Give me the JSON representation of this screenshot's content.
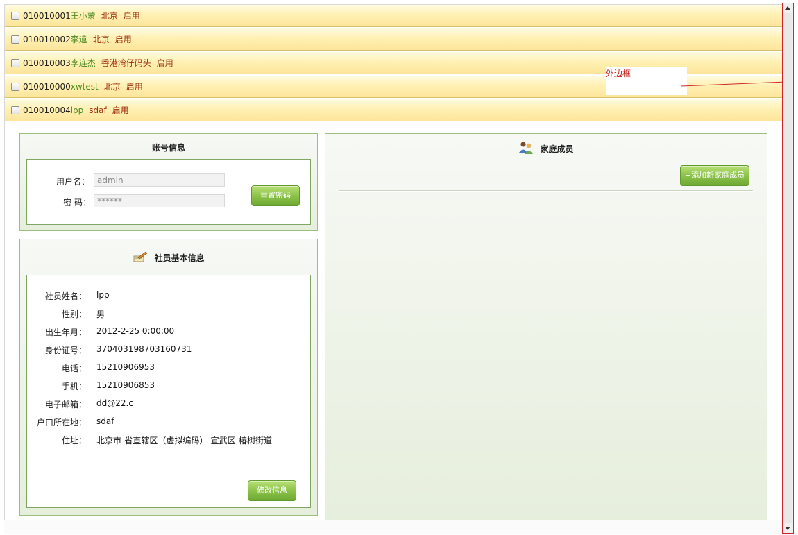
{
  "members": [
    {
      "id": "010010001",
      "name": "王小蒙",
      "location": "北京",
      "status": "启用"
    },
    {
      "id": "010010002",
      "name": "李遠",
      "location": "北京",
      "status": "启用"
    },
    {
      "id": "010010003",
      "name": "李连杰",
      "location": "香港湾仔码头",
      "status": "启用"
    },
    {
      "id": "010010000",
      "name": "xwtest",
      "location": "北京",
      "status": "启用"
    },
    {
      "id": "010010004",
      "name": "lpp",
      "location": "sdaf",
      "status": "启用"
    }
  ],
  "annotation": {
    "label": "外边框"
  },
  "account": {
    "title": "账号信息",
    "username_label": "用户名：",
    "username_value": "admin",
    "password_label": "密 码：",
    "password_value": "******",
    "reset_button": "重置密码"
  },
  "basic_info": {
    "title": "社员基本信息",
    "icon": "edit-notes-icon",
    "fields": [
      {
        "label": "社员姓名：",
        "value": "lpp"
      },
      {
        "label": "性别：",
        "value": "男"
      },
      {
        "label": "出生年月：",
        "value": "2012-2-25 0:00:00"
      },
      {
        "label": "身份证号：",
        "value": "370403198703160731"
      },
      {
        "label": "电话：",
        "value": "15210906953"
      },
      {
        "label": "手机：",
        "value": "15210906853"
      },
      {
        "label": "电子邮箱：",
        "value": "dd@22.c"
      },
      {
        "label": "户口所在地：",
        "value": "sdaf"
      },
      {
        "label": "住址：",
        "value": "北京市-省直辖区（虚拟编码）-宣武区-椿树街道"
      }
    ],
    "edit_button": "修改信息"
  },
  "family": {
    "title": "家庭成员",
    "icon": "family-members-icon",
    "add_button": "+添加新家庭成员"
  },
  "colors": {
    "accent_green": "#8cc34a",
    "row_yellow": "#fde59a",
    "annotation_red": "#d0262a"
  }
}
